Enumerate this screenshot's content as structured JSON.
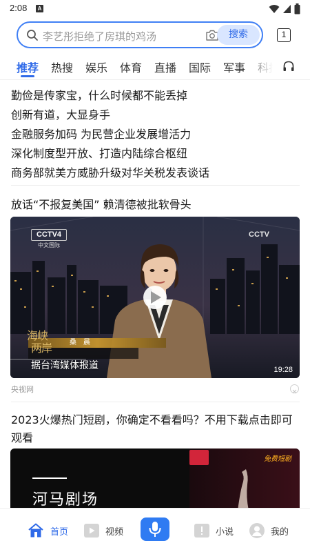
{
  "status_bar": {
    "time": "2:08",
    "notification_letter": "A"
  },
  "search": {
    "placeholder": "李艺彤拒绝了房琪的鸡汤",
    "button_label": "搜索",
    "tab_count": "1"
  },
  "channels": {
    "items": [
      "推荐",
      "热搜",
      "娱乐",
      "体育",
      "直播",
      "国际",
      "军事",
      "科技"
    ],
    "active": "推荐"
  },
  "headlines": [
    "勤俭是传家宝，什么时候都不能丢掉",
    "创新有道，大显身手",
    "金融服务加码 为民营企业发展增活力",
    "深化制度型开放、打造内陆综合枢纽",
    "商务部就美方威胁升级对华关税发表谈话"
  ],
  "article_1": {
    "title": "放话“不报复美国” 赖清德被批软骨头",
    "video": {
      "channel_logo": "CCTV4",
      "channel_sub": "中文国际",
      "logo_right": "CCTV",
      "program_name_line1": "海峡",
      "program_name_line2": "两岸",
      "anchor_name": "桑　晨",
      "caption": "据台湾媒体报道",
      "duration": "19:28"
    },
    "source": "央视网"
  },
  "article_2": {
    "title": "2023火爆热门短剧，你确定不看看吗？不用下载点击即可观看",
    "thumb_text": "河马剧场",
    "badge_text": "免费短剧"
  },
  "bottom_nav": {
    "items": [
      {
        "label": "首页",
        "icon": "home-icon",
        "active": true
      },
      {
        "label": "视频",
        "icon": "video-icon",
        "active": false
      },
      {
        "label": "小说",
        "icon": "novel-icon",
        "active": false
      },
      {
        "label": "我的",
        "icon": "profile-icon",
        "active": false
      }
    ]
  },
  "colors": {
    "accent": "#2f6ae8",
    "search_border": "#3f7ff5",
    "voice_button": "#2f7bf2"
  }
}
